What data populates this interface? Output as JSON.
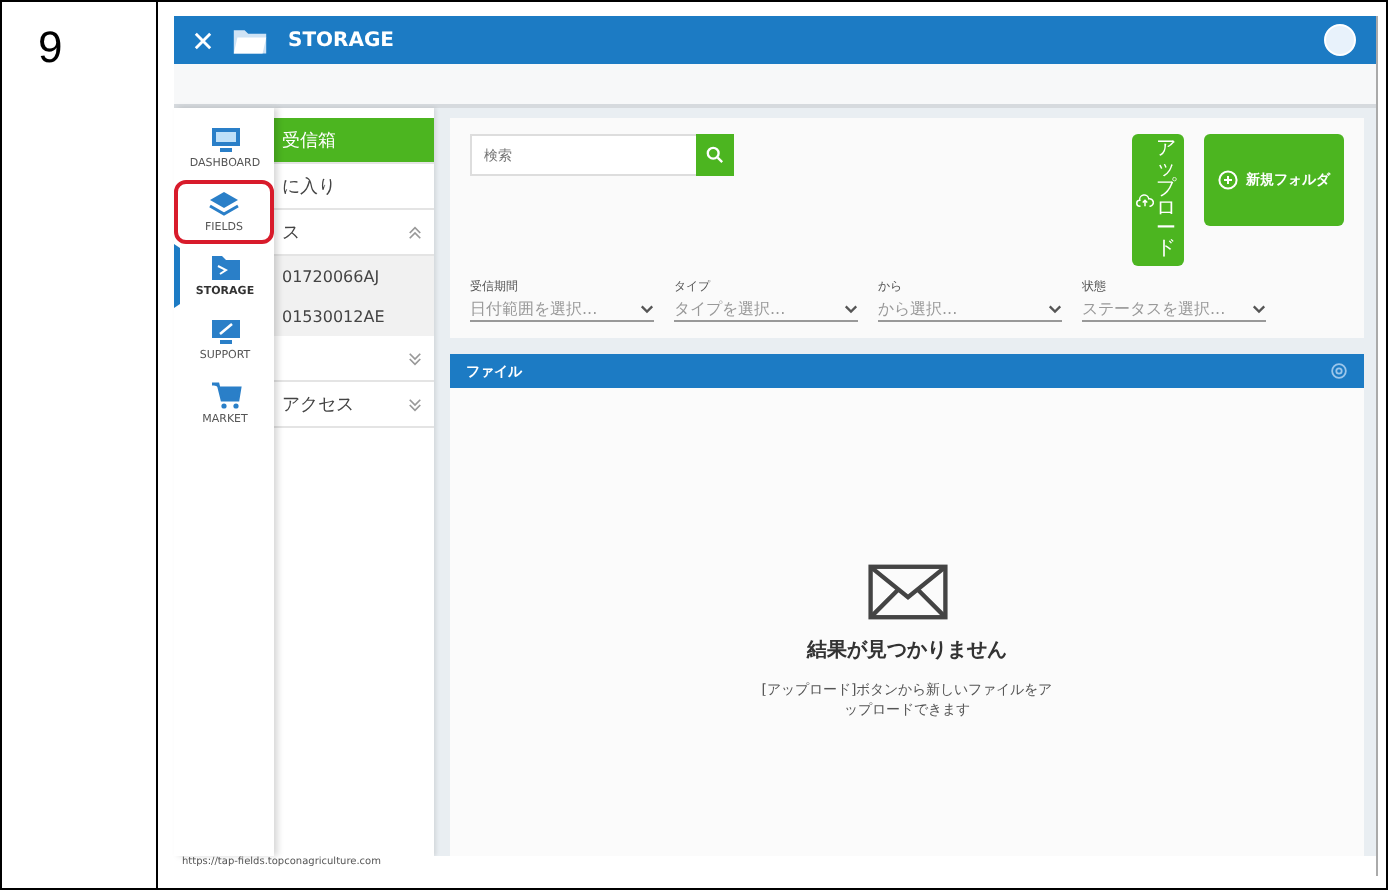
{
  "step_number": "9",
  "app_bar": {
    "title": "STORAGE"
  },
  "nav": [
    {
      "label": "DASHBOARD",
      "kind": "monitor",
      "selected": false,
      "highlighted": false
    },
    {
      "label": "FIELDS",
      "kind": "layers",
      "selected": false,
      "highlighted": true
    },
    {
      "label": "STORAGE",
      "kind": "folder",
      "selected": true,
      "highlighted": false
    },
    {
      "label": "SUPPORT",
      "kind": "screen",
      "selected": false,
      "highlighted": false
    },
    {
      "label": "MARKET",
      "kind": "cart",
      "selected": false,
      "highlighted": false
    }
  ],
  "folders": [
    {
      "label": "受信箱",
      "selected": true
    },
    {
      "label": "に入り",
      "selected": false
    },
    {
      "label": "ス",
      "selected": false,
      "expanded": true,
      "children": [
        {
          "label": "01720066AJ"
        },
        {
          "label": "01530012AE"
        }
      ]
    },
    {
      "selected": false,
      "expanded": false
    },
    {
      "label": "アクセス",
      "selected": false,
      "expanded": false
    }
  ],
  "search": {
    "placeholder": "検索"
  },
  "upload_button": "アップロード",
  "new_folder_button": "新規フォルダ",
  "filters": [
    {
      "label": "受信期間",
      "placeholder": "日付範囲を選択..."
    },
    {
      "label": "タイプ",
      "placeholder": "タイプを選択..."
    },
    {
      "label": "から",
      "placeholder": "から選択..."
    },
    {
      "label": "状態",
      "placeholder": "ステータスを選択..."
    }
  ],
  "files_panel": {
    "title": "ファイル",
    "empty_title": "結果が見つかりません",
    "empty_text": "[アップロード]ボタンから新しいファイルをアップロードできます"
  },
  "status_url": "https://tap-fields.topconagriculture.com"
}
